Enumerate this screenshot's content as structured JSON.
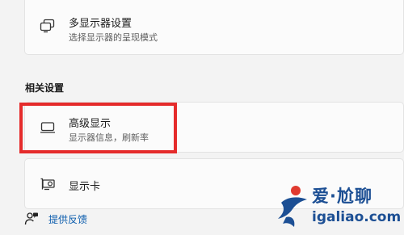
{
  "display_settings": {
    "multi_display": {
      "icon": "multi-display-icon",
      "title": "多显示器设置",
      "subtitle": "选择显示器的呈现模式"
    },
    "related_settings": {
      "header": "相关设置",
      "items": [
        {
          "icon": "monitor-icon",
          "title": "高级显示",
          "subtitle": "显示器信息，刷新率",
          "highlighted": true
        },
        {
          "icon": "graphics-card-icon",
          "title": "显示卡"
        }
      ]
    },
    "feedback": {
      "icon": "feedback-icon",
      "label": "提供反馈"
    }
  },
  "watermark": {
    "title": "爱·尬聊",
    "url": "igaliao.com",
    "colors": {
      "blue": "#1c4f94",
      "red": "#e03a2f"
    }
  },
  "colors": {
    "background": "#f3f3f3",
    "card": "#fbfbfb",
    "highlight_border": "#e52b2b",
    "link": "#0b5cad"
  }
}
